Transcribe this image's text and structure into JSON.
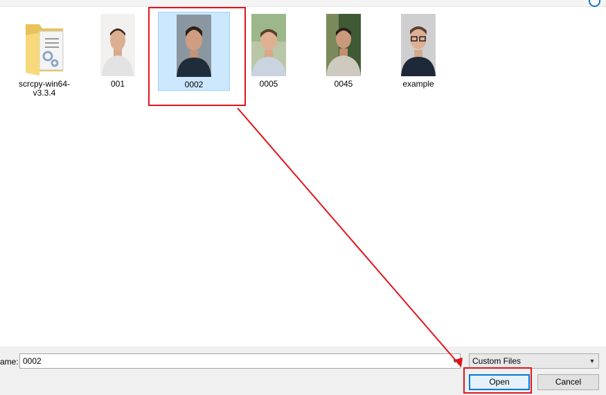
{
  "files": [
    {
      "name": "scrcpy-win64-v3.3.4",
      "type": "folder"
    },
    {
      "name": "001",
      "type": "image"
    },
    {
      "name": "0002",
      "type": "image",
      "selected": true
    },
    {
      "name": "0005",
      "type": "image"
    },
    {
      "name": "0045",
      "type": "image"
    },
    {
      "name": "example",
      "type": "image"
    }
  ],
  "footer": {
    "filename_label": "ame:",
    "filename_value": "0002",
    "filter_value": "Custom Files",
    "open_label": "Open",
    "cancel_label": "Cancel"
  },
  "colors": {
    "selection": "#cce8ff",
    "annotation": "#e0141b",
    "primary_border": "#0078d7"
  }
}
